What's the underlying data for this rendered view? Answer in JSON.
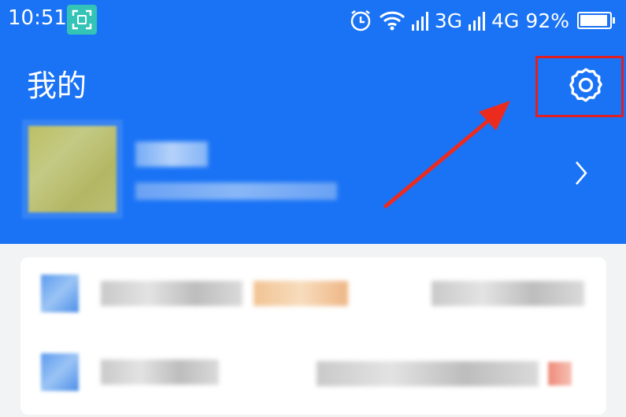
{
  "status": {
    "time": "10:51",
    "net1": "3G",
    "net2": "4G",
    "battery": "92%",
    "battery_level": 0.92,
    "icons": [
      "scan-icon",
      "alarm-icon",
      "wifi-icon",
      "signal-icon",
      "battery-icon"
    ]
  },
  "header": {
    "title": "我的",
    "settings_icon": "gear-icon"
  },
  "profile": {
    "chevron_icon": "chevron-right-icon"
  },
  "colors": {
    "primary": "#1a73f5",
    "highlight": "#e02020",
    "card": "#ffffff",
    "background": "#f2f3f5"
  }
}
